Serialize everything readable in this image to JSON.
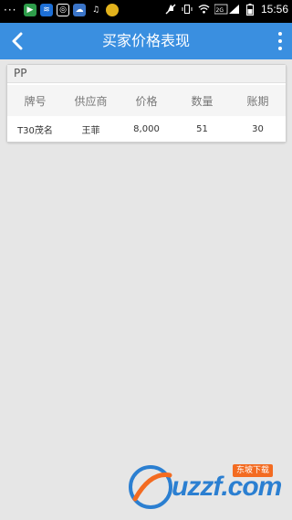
{
  "status_bar": {
    "time": "15:56",
    "left_icons": [
      "more-dots-icon",
      "play-store-icon",
      "download-icon",
      "screenshot-icon",
      "cloud-icon",
      "headset-icon",
      "chat-icon"
    ],
    "right_icons": [
      "mute-icon",
      "vibrate-icon",
      "wifi-icon",
      "signal-icon",
      "battery-icon"
    ],
    "signal_label": "2G/3G"
  },
  "app_bar": {
    "title": "买家价格表现",
    "color": "#3a8fe0"
  },
  "card": {
    "title": "PP",
    "columns": [
      "牌号",
      "供应商",
      "价格",
      "数量",
      "账期"
    ],
    "rows": [
      [
        "T30茂名",
        "王菲",
        "8,000",
        "51",
        "30"
      ]
    ]
  },
  "watermark": {
    "text": "uzzf.com",
    "badge": "东坡下载"
  }
}
